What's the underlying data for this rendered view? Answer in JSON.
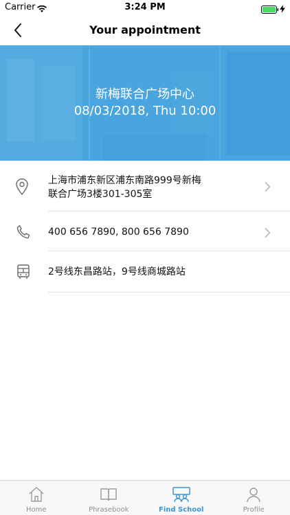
{
  "status_bar": {
    "carrier": "Carrier",
    "time": "3:24 PM"
  },
  "nav": {
    "title": "Your appointment",
    "back_icon": "chevron-left-icon"
  },
  "banner": {
    "center_name": "新梅联合广场中心",
    "datetime": "08/03/2018, Thu 10:00"
  },
  "rows": [
    {
      "icon": "location-pin-icon",
      "line1": "上海市浦东新区浦东南路999号新梅",
      "line2": "联合广场3楼301-305室",
      "has_chevron": true
    },
    {
      "icon": "phone-icon",
      "line1": "400 656 7890, 800 656 7890",
      "has_chevron": true
    },
    {
      "icon": "bus-icon",
      "line1": "2号线东昌路站，9号线商城路站",
      "has_chevron": false
    }
  ],
  "tabs": [
    {
      "label": "Home",
      "icon": "home-icon",
      "active": false
    },
    {
      "label": "Phrasebook",
      "icon": "book-icon",
      "active": false
    },
    {
      "label": "Find School",
      "icon": "classroom-icon",
      "active": true
    },
    {
      "label": "Profile",
      "icon": "person-icon",
      "active": false
    }
  ],
  "colors": {
    "accent": "#3a95d4",
    "banner": "#4aa5de",
    "inactive_tab": "#8e8e93"
  }
}
